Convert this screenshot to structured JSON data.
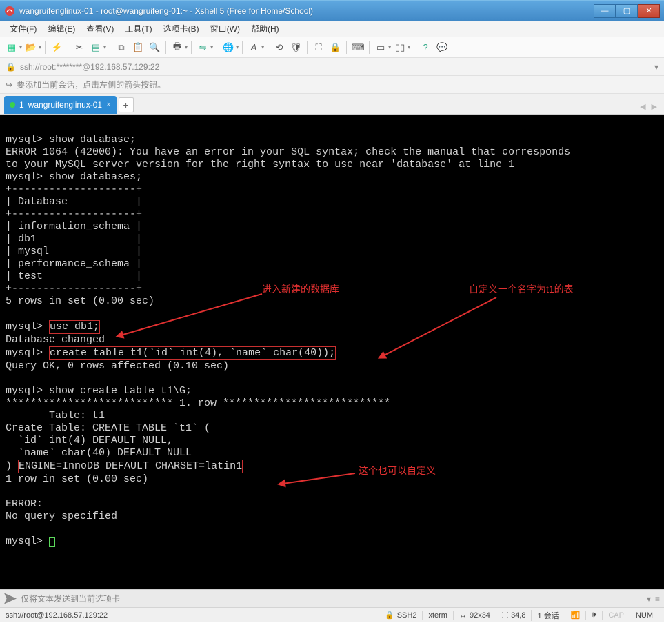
{
  "window": {
    "title": "wangruifenglinux-01 - root@wangruifeng-01:~ - Xshell 5 (Free for Home/School)"
  },
  "menu": {
    "file": "文件(F)",
    "edit": "编辑(E)",
    "view": "查看(V)",
    "tools": "工具(T)",
    "tabs": "选项卡(B)",
    "window": "窗口(W)",
    "help": "帮助(H)"
  },
  "addr": {
    "path": "ssh://root:********@192.168.57.129:22"
  },
  "hint": {
    "text": "要添加当前会话，点击左侧的箭头按钮。"
  },
  "tab": {
    "num": "1",
    "label": "wangruifenglinux-01"
  },
  "term": {
    "l1": "mysql> show database;",
    "l2": "ERROR 1064 (42000): You have an error in your SQL syntax; check the manual that corresponds",
    "l3": "to your MySQL server version for the right syntax to use near 'database' at line 1",
    "l4": "mysql> show databases;",
    "l5": "+--------------------+",
    "l6": "| Database           |",
    "l7": "+--------------------+",
    "l8": "| information_schema |",
    "l9": "| db1                |",
    "l10": "| mysql              |",
    "l11": "| performance_schema |",
    "l12": "| test               |",
    "l13": "+--------------------+",
    "l14": "5 rows in set (0.00 sec)",
    "l15a": "mysql> ",
    "l15b": "use db1;",
    "l16": "Database changed",
    "l17a": "mysql> ",
    "l17b": "create table t1(`id` int(4), `name` char(40));",
    "l18": "Query OK, 0 rows affected (0.10 sec)",
    "l19": "mysql> show create table t1\\G;",
    "l20": "*************************** 1. row ***************************",
    "l21": "       Table: t1",
    "l22": "Create Table: CREATE TABLE `t1` (",
    "l23": "  `id` int(4) DEFAULT NULL,",
    "l24": "  `name` char(40) DEFAULT NULL",
    "l25a": ") ",
    "l25b": "ENGINE=InnoDB DEFAULT CHARSET=latin1",
    "l26": "1 row in set (0.00 sec)",
    "l27": "ERROR:",
    "l28": "No query specified",
    "l29": "mysql> "
  },
  "anno": {
    "a1": "进入新建的数据库",
    "a2": "自定义一个名字为t1的表",
    "a3": "这个也可以自定义"
  },
  "sendbar": {
    "placeholder": "仅将文本发送到当前选项卡"
  },
  "status": {
    "left": "ssh://root@192.168.57.129:22",
    "ssh": "SSH2",
    "term": "xterm",
    "size": "92x34",
    "pos": "34,8",
    "sess": "1 会话",
    "cap": "CAP",
    "num": "NUM"
  }
}
